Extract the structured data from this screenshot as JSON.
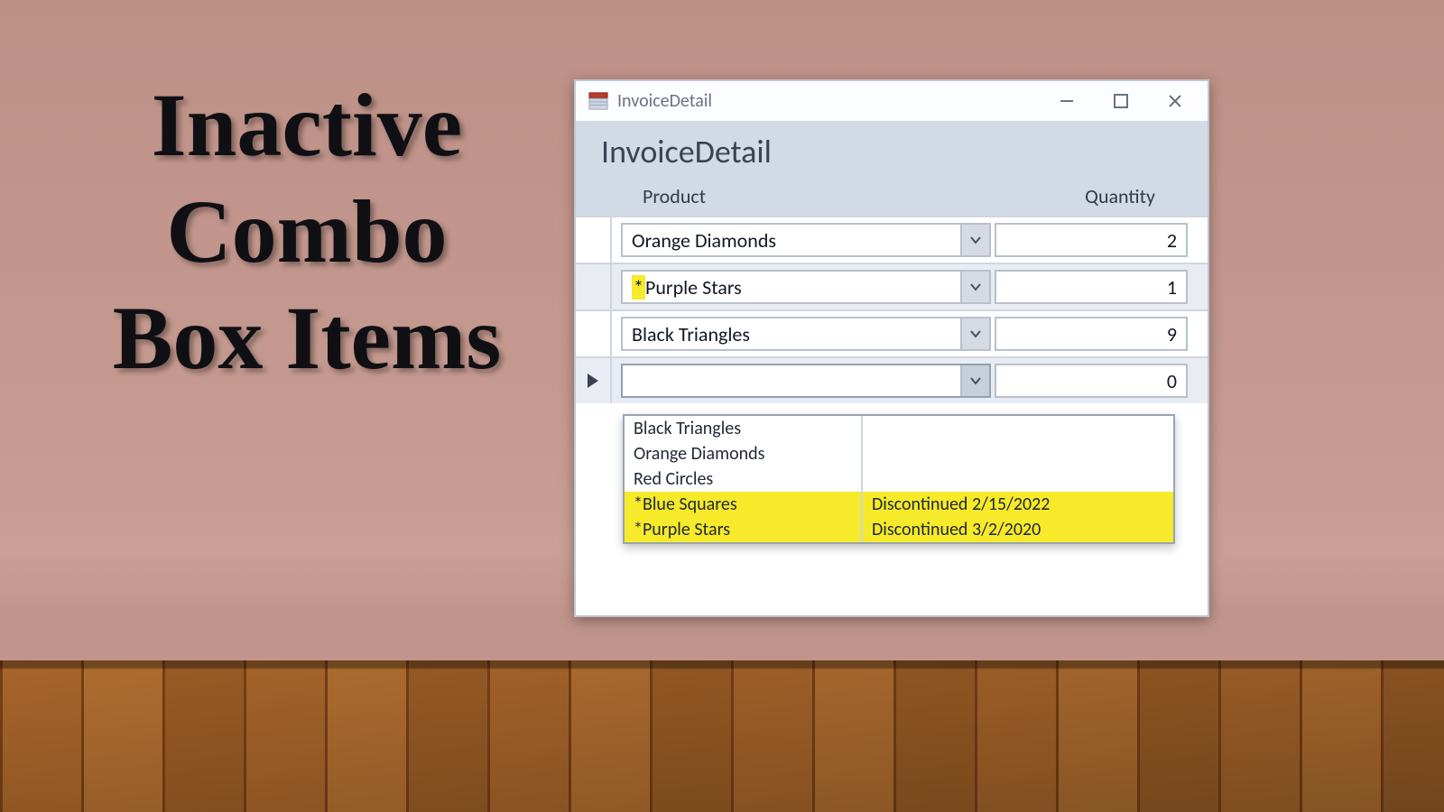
{
  "hero": {
    "title": "Inactive Combo Box Items"
  },
  "window": {
    "title": "InvoiceDetail"
  },
  "form": {
    "title": "InvoiceDetail",
    "columns": {
      "product": "Product",
      "quantity": "Quantity"
    },
    "rows": [
      {
        "product": "Orange Diamonds",
        "quantity": "2"
      },
      {
        "marker": "*",
        "product": "Purple Stars",
        "quantity": "1"
      },
      {
        "product": "Black Triangles",
        "quantity": "9"
      },
      {
        "product": "",
        "quantity": "0"
      }
    ]
  },
  "dropdown": {
    "items": [
      {
        "name": "Black Triangles",
        "status": ""
      },
      {
        "name": "Orange Diamonds",
        "status": ""
      },
      {
        "name": "Red Circles",
        "status": ""
      },
      {
        "name": "*Blue Squares",
        "status": "Discontinued 2/15/2022"
      },
      {
        "name": "*Purple Stars",
        "status": "Discontinued 3/2/2020"
      }
    ]
  }
}
